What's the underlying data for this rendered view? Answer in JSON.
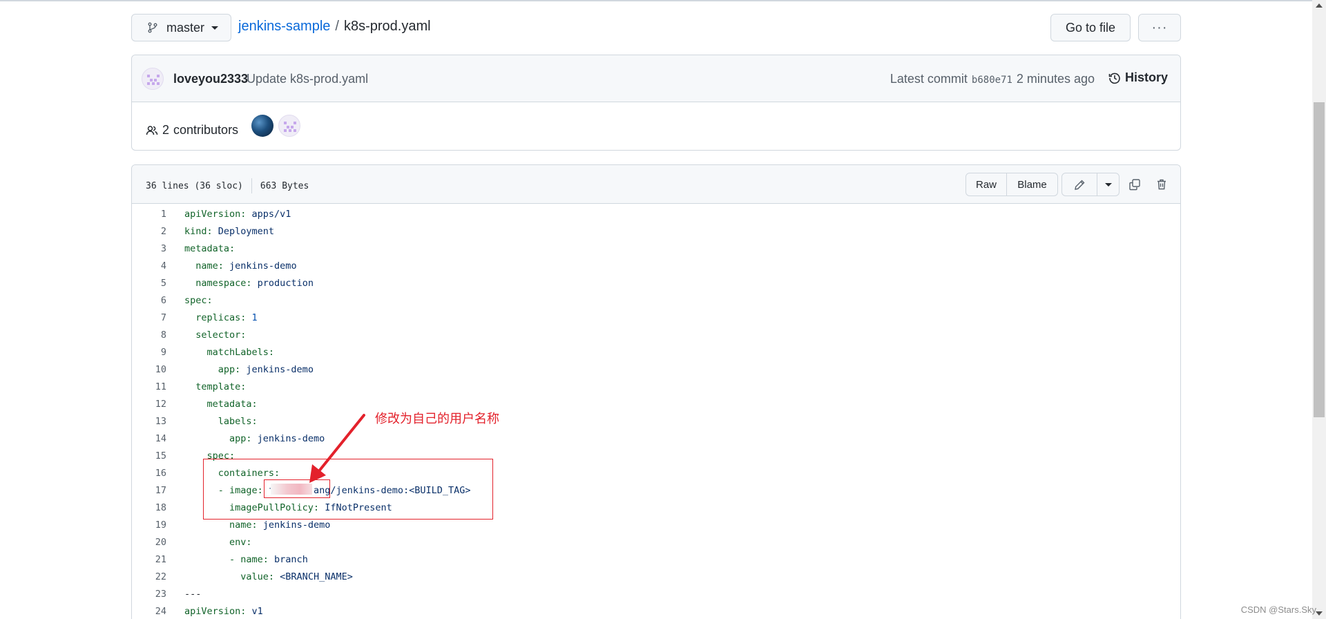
{
  "header": {
    "branch": "master",
    "repo": "jenkins-sample",
    "separator": "/",
    "file": "k8s-prod.yaml",
    "goto_label": "Go to file",
    "more_label": "···"
  },
  "commit": {
    "author": "loveyou2333",
    "message": "Update k8s-prod.yaml",
    "latest_label": "Latest commit",
    "sha": "b680e71",
    "time": "2 minutes ago",
    "history_label": "History"
  },
  "contributors": {
    "count": "2",
    "label": "contributors"
  },
  "file": {
    "lines_info": "36 lines (36 sloc)",
    "size": "663 Bytes",
    "raw_label": "Raw",
    "blame_label": "Blame"
  },
  "code_lines": [
    {
      "n": "1",
      "key": "apiVersion:",
      "val": " apps/v1"
    },
    {
      "n": "2",
      "key": "kind:",
      "val": " Deployment"
    },
    {
      "n": "3",
      "key": "metadata:",
      "val": ""
    },
    {
      "n": "4",
      "key": "  name:",
      "val": " jenkins-demo"
    },
    {
      "n": "5",
      "key": "  namespace:",
      "val": " production"
    },
    {
      "n": "6",
      "key": "spec:",
      "val": ""
    },
    {
      "n": "7",
      "key": "  replicas:",
      "val": " 1"
    },
    {
      "n": "8",
      "key": "  selector:",
      "val": ""
    },
    {
      "n": "9",
      "key": "    matchLabels:",
      "val": ""
    },
    {
      "n": "10",
      "key": "      app:",
      "val": " jenkins-demo"
    },
    {
      "n": "11",
      "key": "  template:",
      "val": ""
    },
    {
      "n": "12",
      "key": "    metadata:",
      "val": ""
    },
    {
      "n": "13",
      "key": "      labels:",
      "val": ""
    },
    {
      "n": "14",
      "key": "        app:",
      "val": " jenkins-demo"
    },
    {
      "n": "15",
      "key": "    spec:",
      "val": ""
    },
    {
      "n": "16",
      "key": "      containers:",
      "val": ""
    },
    {
      "n": "17",
      "key": "      - image:",
      "val": " fu      ang/jenkins-demo:<BUILD_TAG>"
    },
    {
      "n": "18",
      "key": "        imagePullPolicy:",
      "val": " IfNotPresent"
    },
    {
      "n": "19",
      "key": "        name:",
      "val": " jenkins-demo"
    },
    {
      "n": "20",
      "key": "        env:",
      "val": ""
    },
    {
      "n": "21",
      "key": "        - name:",
      "val": " branch"
    },
    {
      "n": "22",
      "key": "          value:",
      "val": " <BRANCH_NAME>"
    },
    {
      "n": "23",
      "key": "---",
      "val": ""
    },
    {
      "n": "24",
      "key": "apiVersion:",
      "val": " v1"
    }
  ],
  "annotation": {
    "text": "修改为自己的用户名称",
    "color": "#e3212b"
  },
  "watermark": "CSDN @Stars.Sky",
  "colors": {
    "link": "#0969da",
    "key": "#116329",
    "string": "#0a3069",
    "number": "#0550ae"
  }
}
